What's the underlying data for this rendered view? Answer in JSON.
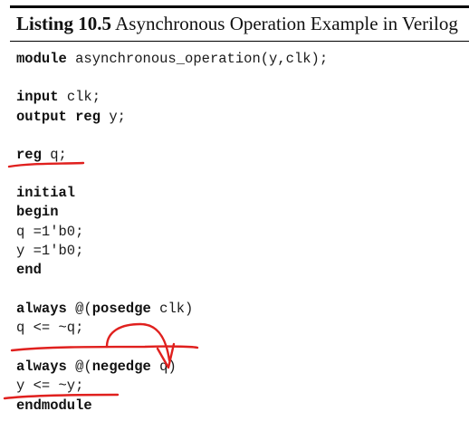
{
  "listing": {
    "label": "Listing 10.5",
    "caption": " Asynchronous Operation Example in Verilog"
  },
  "code": [
    {
      "kw": "module",
      "rest": " asynchronous_operation(y,clk);"
    },
    {
      "kw": "input",
      "rest": " clk;"
    },
    {
      "kw": "output reg",
      "rest": " y;"
    },
    {
      "kw": "reg",
      "rest": " q;"
    },
    {
      "kw": "initial",
      "rest": ""
    },
    {
      "kw": "begin",
      "rest": ""
    },
    {
      "kw": "",
      "rest": "q =1'b0;"
    },
    {
      "kw": "",
      "rest": "y =1'b0;"
    },
    {
      "kw": "end",
      "rest": ""
    },
    {
      "kw": "always",
      "rest": " @(",
      "kw2": "posedge",
      "rest2": " clk)"
    },
    {
      "kw": "",
      "rest": "q <= ~q;"
    },
    {
      "kw": "always",
      "rest": " @(",
      "kw2": "negedge",
      "rest2": " q)"
    },
    {
      "kw": "",
      "rest": "y <= ~y;"
    },
    {
      "kw": "endmodule",
      "rest": ""
    }
  ],
  "annotation_color": "#e0201e"
}
